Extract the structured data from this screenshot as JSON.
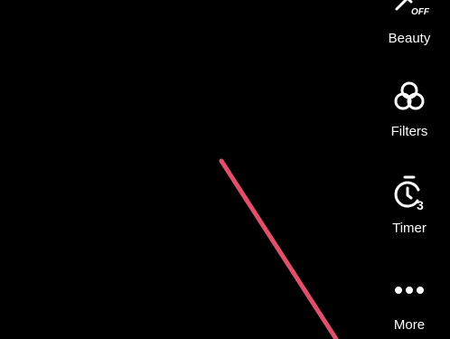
{
  "side_toolbar": {
    "beauty": {
      "label": "Beauty",
      "icon": "beauty-off-icon",
      "badge": "OFF"
    },
    "filters": {
      "label": "Filters",
      "icon": "filters-icon"
    },
    "timer": {
      "label": "Timer",
      "icon": "timer-3s-icon",
      "value": "3"
    },
    "more": {
      "label": "More",
      "icon": "more-dots-icon"
    }
  },
  "colors": {
    "background": "#000000",
    "icon": "#ffffff",
    "annotation_line": "#e0506a"
  }
}
